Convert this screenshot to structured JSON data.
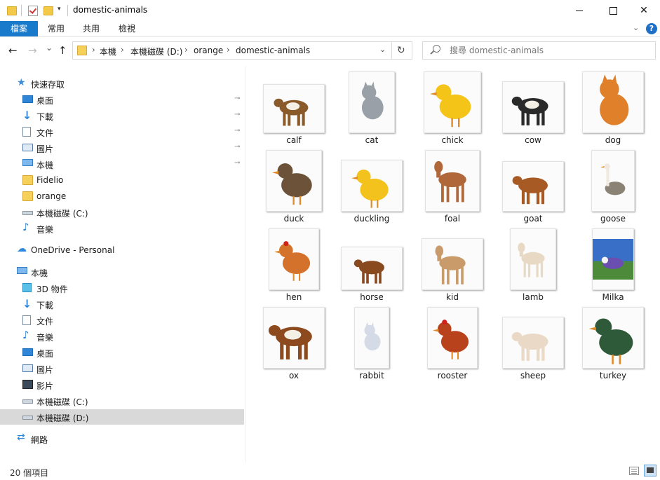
{
  "window": {
    "title": "domestic-animals",
    "minimize_icon": "minimize-icon",
    "maximize_icon": "maximize-icon",
    "close_glyph": "✕"
  },
  "ribbon": {
    "tabs": [
      "檔案",
      "常用",
      "共用",
      "檢視"
    ],
    "help": "?",
    "accent": "#1979ca"
  },
  "nav": {
    "back": "←",
    "forward": "→",
    "recent": "⌄",
    "up": "↑",
    "breadcrumb": [
      "本機",
      "本機磁碟 (D:)",
      "orange",
      "domestic-animals"
    ],
    "crumb_sep": "›",
    "dropdown": "⌄",
    "refresh": "↻",
    "search_placeholder": "搜尋 domestic-animals"
  },
  "sidebar": {
    "quick_access": "快速存取",
    "quick_items": [
      {
        "label": "桌面",
        "icon": "desktop-icon",
        "pinned": true
      },
      {
        "label": "下載",
        "icon": "download-icon",
        "pinned": true
      },
      {
        "label": "文件",
        "icon": "document-icon",
        "pinned": true
      },
      {
        "label": "圖片",
        "icon": "pictures-icon",
        "pinned": true
      },
      {
        "label": "本機",
        "icon": "pc-icon",
        "pinned": true
      },
      {
        "label": "Fidelio",
        "icon": "folder-icon",
        "pinned": false
      },
      {
        "label": "orange",
        "icon": "folder-icon",
        "pinned": false
      },
      {
        "label": "本機磁碟 (C:)",
        "icon": "drive-icon",
        "pinned": false
      },
      {
        "label": "音樂",
        "icon": "music-icon",
        "pinned": false
      }
    ],
    "onedrive": "OneDrive - Personal",
    "this_pc": "本機",
    "pc_items": [
      {
        "label": "3D 物件",
        "icon": "3d-objects-icon"
      },
      {
        "label": "下載",
        "icon": "download-icon"
      },
      {
        "label": "文件",
        "icon": "document-icon"
      },
      {
        "label": "音樂",
        "icon": "music-icon"
      },
      {
        "label": "桌面",
        "icon": "desktop-icon"
      },
      {
        "label": "圖片",
        "icon": "pictures-icon"
      },
      {
        "label": "影片",
        "icon": "videos-icon"
      },
      {
        "label": "本機磁碟 (C:)",
        "icon": "drive-icon"
      },
      {
        "label": "本機磁碟 (D:)",
        "icon": "drive-icon",
        "selected": true
      }
    ],
    "network": "網路",
    "pin_glyph": "📌"
  },
  "files": [
    {
      "name": "calf",
      "color": "#8a5a2b",
      "kind": "quadruped"
    },
    {
      "name": "cat",
      "color": "#9aa0a8",
      "kind": "sitting"
    },
    {
      "name": "chick",
      "color": "#f5c419",
      "kind": "bird"
    },
    {
      "name": "cow",
      "color": "#2a2a2a",
      "kind": "quadruped"
    },
    {
      "name": "dog",
      "color": "#e0802a",
      "kind": "sitting"
    },
    {
      "name": "duck",
      "color": "#6b5238",
      "kind": "bird"
    },
    {
      "name": "duckling",
      "color": "#f4c21c",
      "kind": "bird"
    },
    {
      "name": "foal",
      "color": "#b0683a",
      "kind": "standing"
    },
    {
      "name": "goat",
      "color": "#a85a24",
      "kind": "quadruped"
    },
    {
      "name": "goose",
      "color": "#8a8275",
      "kind": "tallbird"
    },
    {
      "name": "hen",
      "color": "#d4712a",
      "kind": "bird"
    },
    {
      "name": "horse",
      "color": "#8a4a20",
      "kind": "running"
    },
    {
      "name": "kid",
      "color": "#c99a6a",
      "kind": "standing"
    },
    {
      "name": "lamb",
      "color": "#e8d9c4",
      "kind": "standing"
    },
    {
      "name": "Milka",
      "color": "#6a4fb0",
      "kind": "photo"
    },
    {
      "name": "ox",
      "color": "#8c4a1e",
      "kind": "quadruped"
    },
    {
      "name": "rabbit",
      "color": "#d4dbe6",
      "kind": "sitting"
    },
    {
      "name": "rooster",
      "color": "#b8421c",
      "kind": "bird"
    },
    {
      "name": "sheep",
      "color": "#ead9c6",
      "kind": "quadruped"
    },
    {
      "name": "turkey",
      "color": "#2f5a3a",
      "kind": "bird"
    }
  ],
  "status": {
    "item_count": "20 個項目"
  }
}
